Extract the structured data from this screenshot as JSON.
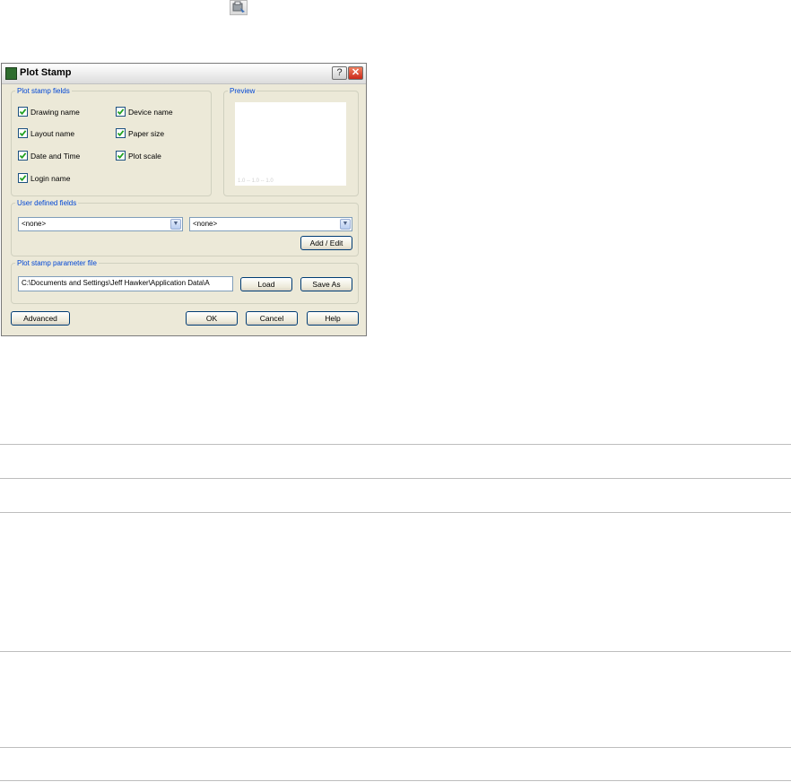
{
  "top_icon": "plot-stamp-toolbar-icon",
  "dialog": {
    "title": "Plot Stamp",
    "help_glyph": "?",
    "close_glyph": "✕",
    "groups": {
      "fields_legend": "Plot stamp fields",
      "preview_legend": "Preview",
      "user_legend": "User defined fields",
      "param_legend": "Plot stamp parameter file"
    },
    "fields": {
      "drawing_name": "Drawing name",
      "device_name": "Device name",
      "layout_name": "Layout name",
      "paper_size": "Paper size",
      "date_time": "Date and Time",
      "plot_scale": "Plot scale",
      "login_name": "Login name"
    },
    "checked": {
      "drawing_name": true,
      "device_name": true,
      "layout_name": true,
      "paper_size": true,
      "date_time": true,
      "plot_scale": true,
      "login_name": true
    },
    "preview_text": "1.0 -- 1.0 -- 1.0",
    "user_fields": {
      "combo1_value": "<none>",
      "combo2_value": "<none>",
      "add_edit_label": "Add / Edit"
    },
    "param_file": {
      "path": "C:\\Documents and Settings\\Jeff Hawker\\Application Data\\A",
      "load_label": "Load",
      "save_as_label": "Save As"
    },
    "buttons": {
      "advanced": "Advanced",
      "ok": "OK",
      "cancel": "Cancel",
      "help": "Help"
    }
  },
  "colors": {
    "dialog_bg": "#ece9d8",
    "legend_blue": "#0046d5",
    "check_green": "#21a121"
  }
}
